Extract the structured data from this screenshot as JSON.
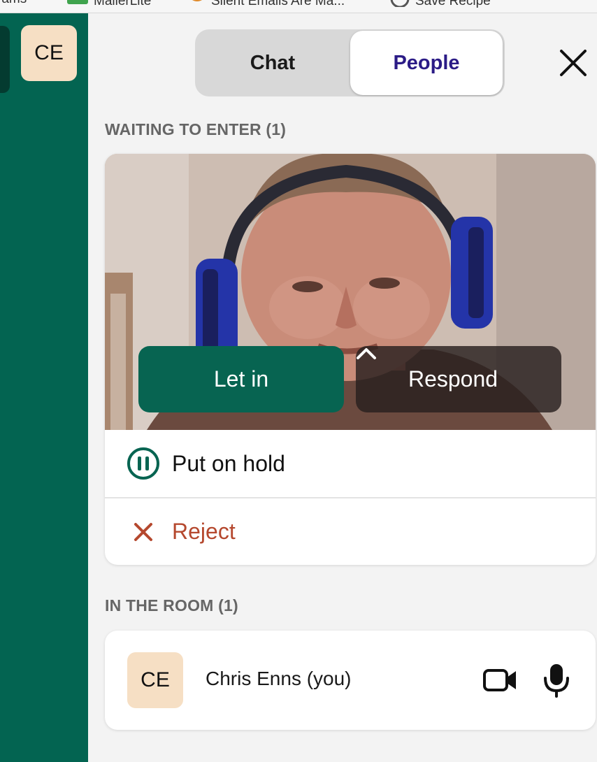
{
  "bookmarks": [
    {
      "label": "rams",
      "icon": "bookmark-icon"
    },
    {
      "label": "MailerLite",
      "icon": "chat-bubble-icon"
    },
    {
      "label": "Silent Emails Are Ma...",
      "icon": "croissant-icon"
    },
    {
      "label": "Save Recipe",
      "icon": "globe-icon"
    }
  ],
  "sidebar": {
    "avatar_initials": "CE"
  },
  "tabs": {
    "chat_label": "Chat",
    "people_label": "People",
    "active": "People"
  },
  "waiting": {
    "heading": "WAITING TO ENTER (1)",
    "let_in_label": "Let in",
    "respond_label": "Respond",
    "put_on_hold_label": "Put on hold",
    "reject_label": "Reject"
  },
  "room": {
    "heading": "IN THE ROOM (1)",
    "participant": {
      "initials": "CE",
      "name": "Chris Enns (you)"
    }
  },
  "colors": {
    "sidebar": "#036451",
    "let_in": "#076451",
    "people_tab_text": "#2b1b86",
    "reject": "#b5482e",
    "avatar_bg": "#f6dfc4"
  }
}
